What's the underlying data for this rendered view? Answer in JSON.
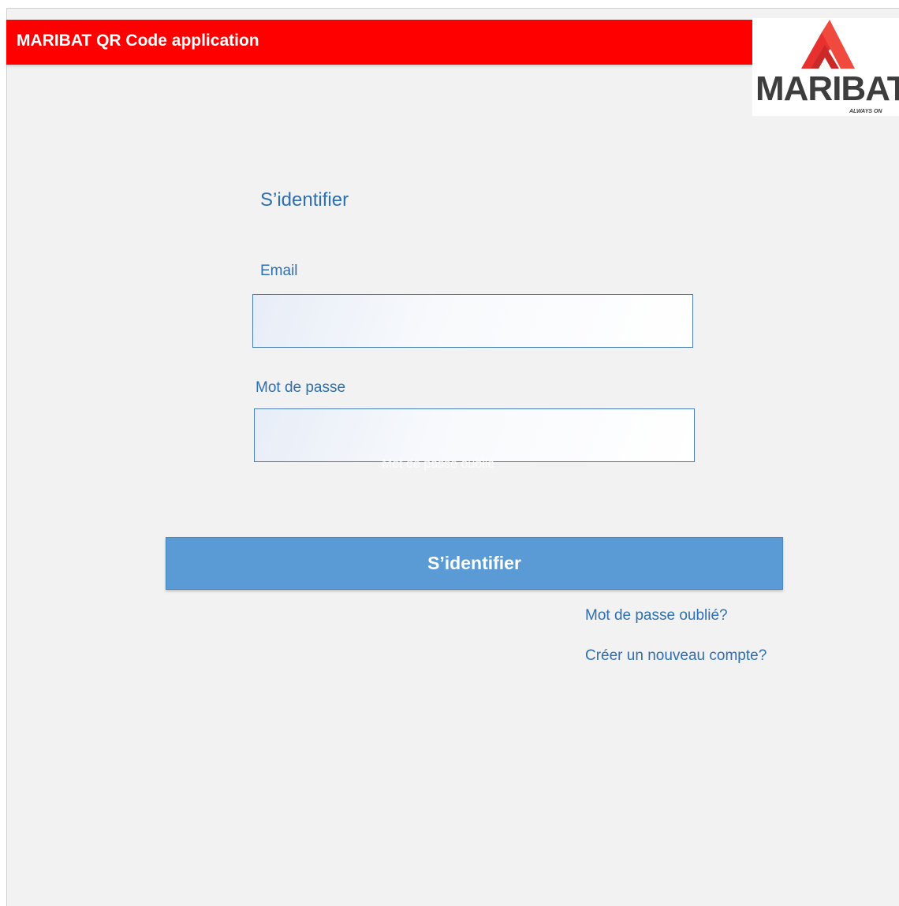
{
  "app": {
    "title": "MARIBAT QR Code application"
  },
  "logo": {
    "wordmark": "MARIBAT",
    "tagline": "ALWAYS ON",
    "trademark": "™",
    "colors": {
      "primary": "#e8312f",
      "secondary": "#f04a3e",
      "text": "#3d3d3d"
    }
  },
  "login_form": {
    "title": "S’identifier",
    "email_label": "Email",
    "email_value": "",
    "password_label": "Mot de passe",
    "password_value": "",
    "ghost_hint": "Mot de passe oublié",
    "submit_label": "S’identifier",
    "forgot_password_link": "Mot de passe oublié?",
    "create_account_link": "Créer un nouveau compte?"
  },
  "colors": {
    "header_bg": "#ff0000",
    "page_bg": "#f2f2f2",
    "accent_text": "#2e6fb3",
    "button_bg": "#5b9bd5",
    "input_border": "#4a7ebb"
  }
}
